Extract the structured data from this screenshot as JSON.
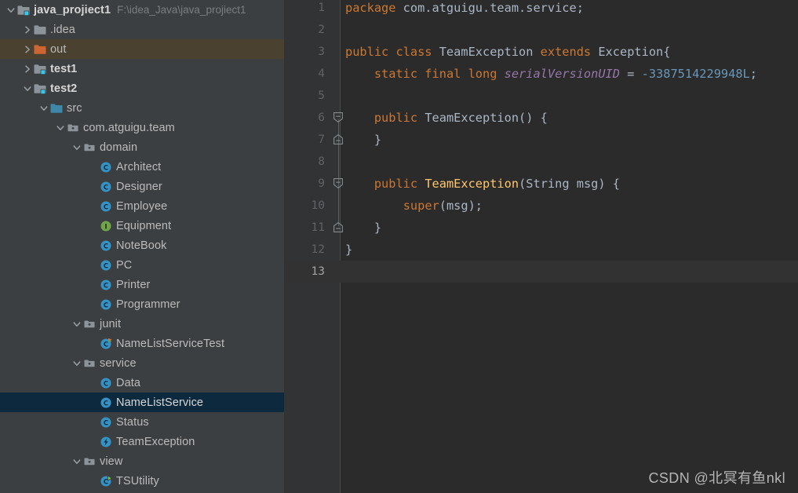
{
  "project": {
    "name": "java_projiect1",
    "path": "F:\\idea_Java\\java_projiect1",
    "root_icon": "module-folder-icon",
    "expanded_chevron": "chevron-down-icon"
  },
  "colors": {
    "panel_bg": "#3c3f41",
    "editor_bg": "#2b2b2b",
    "gutter_bg": "#313335",
    "selection_bg": "#0d293e",
    "hover_bg": "#4b4130",
    "current_line_bg": "#323232",
    "text": "#bbbbbb",
    "keyword": "#cc7832",
    "number": "#6897bb",
    "field_italic": "#9876aa",
    "method": "#ffc66d",
    "class_icon": "#3592c4",
    "interface_icon": "#6fa44a",
    "folder_orange": "#cc6633",
    "folder_blue": "#3d88a8"
  },
  "tree": [
    {
      "label": "java_projiect1",
      "path": "F:\\idea_Java\\java_projiect1",
      "depth": 0,
      "chevron": "chevron-down-icon",
      "icon": "module-folder-icon",
      "bold": true,
      "state": "normal"
    },
    {
      "label": ".idea",
      "depth": 1,
      "chevron": "chevron-right-icon",
      "icon": "folder-gray-icon",
      "bold": false,
      "state": "normal"
    },
    {
      "label": "out",
      "depth": 1,
      "chevron": "chevron-right-icon",
      "icon": "folder-orange-icon",
      "bold": false,
      "state": "hovered"
    },
    {
      "label": "test1",
      "depth": 1,
      "chevron": "chevron-right-icon",
      "icon": "module-folder-icon",
      "bold": true,
      "state": "normal"
    },
    {
      "label": "test2",
      "depth": 1,
      "chevron": "chevron-down-icon",
      "icon": "module-folder-icon",
      "bold": true,
      "state": "normal"
    },
    {
      "label": "src",
      "depth": 2,
      "chevron": "chevron-down-icon",
      "icon": "source-folder-icon",
      "bold": false,
      "state": "normal"
    },
    {
      "label": "com.atguigu.team",
      "depth": 3,
      "chevron": "chevron-down-icon",
      "icon": "package-icon",
      "bold": false,
      "state": "normal"
    },
    {
      "label": "domain",
      "depth": 4,
      "chevron": "chevron-down-icon",
      "icon": "package-icon",
      "bold": false,
      "state": "normal"
    },
    {
      "label": "Architect",
      "depth": 5,
      "chevron": "none",
      "icon": "java-class-icon",
      "bold": false,
      "state": "normal"
    },
    {
      "label": "Designer",
      "depth": 5,
      "chevron": "none",
      "icon": "java-class-icon",
      "bold": false,
      "state": "normal"
    },
    {
      "label": "Employee",
      "depth": 5,
      "chevron": "none",
      "icon": "java-class-icon",
      "bold": false,
      "state": "normal"
    },
    {
      "label": "Equipment",
      "depth": 5,
      "chevron": "none",
      "icon": "java-interface-icon",
      "bold": false,
      "state": "normal"
    },
    {
      "label": "NoteBook",
      "depth": 5,
      "chevron": "none",
      "icon": "java-class-icon",
      "bold": false,
      "state": "normal"
    },
    {
      "label": "PC",
      "depth": 5,
      "chevron": "none",
      "icon": "java-class-icon",
      "bold": false,
      "state": "normal"
    },
    {
      "label": "Printer",
      "depth": 5,
      "chevron": "none",
      "icon": "java-class-icon",
      "bold": false,
      "state": "normal"
    },
    {
      "label": "Programmer",
      "depth": 5,
      "chevron": "none",
      "icon": "java-class-icon",
      "bold": false,
      "state": "normal"
    },
    {
      "label": "junit",
      "depth": 4,
      "chevron": "chevron-down-icon",
      "icon": "package-icon",
      "bold": false,
      "state": "normal"
    },
    {
      "label": "NameListServiceTest",
      "depth": 5,
      "chevron": "none",
      "icon": "java-test-class-icon",
      "bold": false,
      "state": "normal"
    },
    {
      "label": "service",
      "depth": 4,
      "chevron": "chevron-down-icon",
      "icon": "package-icon",
      "bold": false,
      "state": "normal"
    },
    {
      "label": "Data",
      "depth": 5,
      "chevron": "none",
      "icon": "java-class-icon",
      "bold": false,
      "state": "normal"
    },
    {
      "label": "NameListService",
      "depth": 5,
      "chevron": "none",
      "icon": "java-class-icon",
      "bold": false,
      "state": "selected"
    },
    {
      "label": "Status",
      "depth": 5,
      "chevron": "none",
      "icon": "java-class-icon",
      "bold": false,
      "state": "normal"
    },
    {
      "label": "TeamException",
      "depth": 5,
      "chevron": "none",
      "icon": "java-exception-class-icon",
      "bold": false,
      "state": "normal"
    },
    {
      "label": "view",
      "depth": 4,
      "chevron": "chevron-down-icon",
      "icon": "package-icon",
      "bold": false,
      "state": "normal"
    },
    {
      "label": "TSUtility",
      "depth": 5,
      "chevron": "none",
      "icon": "java-runnable-class-icon",
      "bold": false,
      "state": "normal"
    }
  ],
  "editor": {
    "file": "TeamException.java",
    "current_line": 13,
    "total_lines": 13,
    "lines": [
      {
        "n": 1,
        "fold": "none",
        "tokens": [
          {
            "t": "kw",
            "v": "package"
          },
          {
            "t": "pln",
            "v": " com.atguigu.team.service;"
          }
        ]
      },
      {
        "n": 2,
        "fold": "none",
        "tokens": []
      },
      {
        "n": 3,
        "fold": "none",
        "tokens": [
          {
            "t": "kw",
            "v": "public class"
          },
          {
            "t": "cls",
            "v": " TeamException "
          },
          {
            "t": "kw",
            "v": "extends"
          },
          {
            "t": "cls",
            "v": " Exception{"
          }
        ]
      },
      {
        "n": 4,
        "fold": "none",
        "tokens": [
          {
            "t": "pln",
            "v": "    "
          },
          {
            "t": "kw",
            "v": "static final long"
          },
          {
            "t": "pln",
            "v": " "
          },
          {
            "t": "fld",
            "v": "serialVersionUID"
          },
          {
            "t": "op",
            "v": " = "
          },
          {
            "t": "num",
            "v": "-3387514229948L"
          },
          {
            "t": "op",
            "v": ";"
          }
        ]
      },
      {
        "n": 5,
        "fold": "none",
        "tokens": []
      },
      {
        "n": 6,
        "fold": "collapse-start",
        "tokens": [
          {
            "t": "pln",
            "v": "    "
          },
          {
            "t": "kw",
            "v": "public"
          },
          {
            "t": "cls",
            "v": " TeamException() {"
          }
        ]
      },
      {
        "n": 7,
        "fold": "collapse-end",
        "tokens": [
          {
            "t": "pln",
            "v": "    }"
          }
        ]
      },
      {
        "n": 8,
        "fold": "none",
        "tokens": []
      },
      {
        "n": 9,
        "fold": "collapse-start",
        "tokens": [
          {
            "t": "pln",
            "v": "    "
          },
          {
            "t": "kw",
            "v": "public"
          },
          {
            "t": "pln",
            "v": " "
          },
          {
            "t": "mth",
            "v": "TeamException"
          },
          {
            "t": "cls",
            "v": "(String msg) {"
          }
        ]
      },
      {
        "n": 10,
        "fold": "none",
        "tokens": [
          {
            "t": "pln",
            "v": "        "
          },
          {
            "t": "kw",
            "v": "super"
          },
          {
            "t": "op",
            "v": "(msg);"
          }
        ]
      },
      {
        "n": 11,
        "fold": "collapse-end",
        "tokens": [
          {
            "t": "pln",
            "v": "    }"
          }
        ]
      },
      {
        "n": 12,
        "fold": "none",
        "tokens": [
          {
            "t": "pln",
            "v": "}"
          }
        ]
      },
      {
        "n": 13,
        "fold": "none",
        "tokens": []
      }
    ]
  },
  "watermark": "CSDN @北冥有鱼nkl"
}
